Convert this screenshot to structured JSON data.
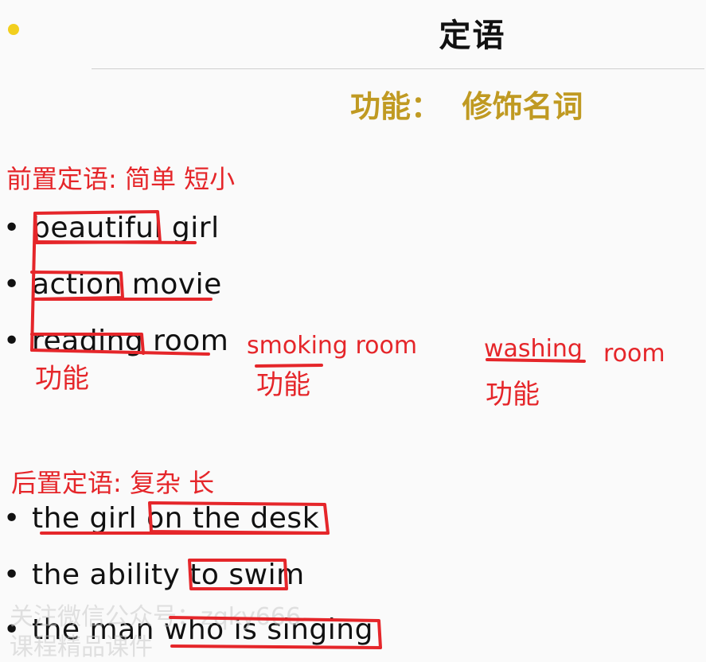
{
  "slide": {
    "title": "定语",
    "function_line": "功能：  修饰名词"
  },
  "pre": {
    "heading": "前置定语: 简单 短小",
    "items": [
      "beautiful girl",
      "action movie",
      "reading room"
    ],
    "note_under_reading": "功能",
    "extra1": "smoking room",
    "extra1_note": "功能",
    "extra2_word": "washing",
    "extra2_tail": "room",
    "extra2_note": "功能"
  },
  "post": {
    "heading": "后置定语: 复杂 长",
    "items": [
      "the girl on the desk",
      "the ability to swim",
      "the man who is singing"
    ]
  },
  "watermark": {
    "line1": "关注微信公众号：zqky666",
    "line2": "课程精品课件"
  },
  "colors": {
    "accent_red": "#e5262a",
    "gold": "#c09a22",
    "dot": "#f2cf1e"
  }
}
